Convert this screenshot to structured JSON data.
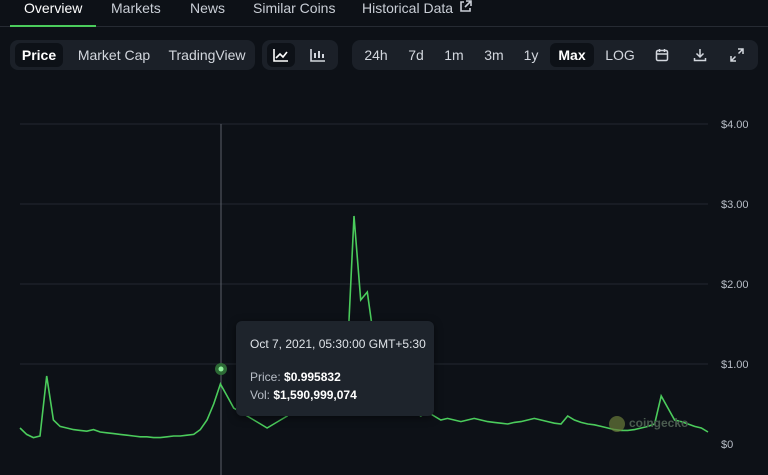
{
  "tabs": [
    {
      "label": "Overview"
    },
    {
      "label": "Markets"
    },
    {
      "label": "News"
    },
    {
      "label": "Similar Coins"
    },
    {
      "label": "Historical Data"
    }
  ],
  "toolbar": {
    "metrics": [
      "Price",
      "Market Cap",
      "TradingView"
    ],
    "selected_metric": "Price",
    "ranges": [
      "24h",
      "7d",
      "1m",
      "3m",
      "1y",
      "Max",
      "LOG"
    ],
    "selected_range": "Max",
    "icons": [
      "line-chart-icon",
      "candlestick-icon",
      "calendar-icon",
      "download-icon",
      "expand-icon"
    ]
  },
  "tooltip": {
    "date": "Oct 7, 2021, 05:30:00 GMT+5:30",
    "price_label": "Price:",
    "price_value": "$0.995832",
    "vol_label": "Vol:",
    "vol_value": "$1,590,999,074"
  },
  "watermark": {
    "text": "coingecko"
  },
  "chart_data": {
    "type": "line",
    "y_ticks": [
      "$4.00",
      "$3.00",
      "$2.00",
      "$1.00",
      "$0"
    ],
    "ylim": [
      0,
      4
    ],
    "grid": true,
    "series": [
      {
        "color": "#4bcc5c",
        "values": [
          0.2,
          0.12,
          0.08,
          0.1,
          0.85,
          0.3,
          0.22,
          0.2,
          0.18,
          0.17,
          0.16,
          0.18,
          0.15,
          0.14,
          0.13,
          0.12,
          0.11,
          0.1,
          0.09,
          0.09,
          0.08,
          0.08,
          0.09,
          0.1,
          0.1,
          0.11,
          0.12,
          0.18,
          0.3,
          0.5,
          0.75,
          0.6,
          0.45,
          0.4,
          0.35,
          0.3,
          0.25,
          0.2,
          0.25,
          0.3,
          0.35,
          0.45,
          0.6,
          0.8,
          0.9,
          0.85,
          0.95,
          1.0,
          0.9,
          1.1,
          2.85,
          1.8,
          1.9,
          1.3,
          1.0,
          0.8,
          0.6,
          0.5,
          0.45,
          0.4,
          0.35,
          0.4,
          0.35,
          0.3,
          0.32,
          0.3,
          0.28,
          0.3,
          0.32,
          0.3,
          0.28,
          0.27,
          0.26,
          0.25,
          0.27,
          0.28,
          0.3,
          0.32,
          0.3,
          0.28,
          0.26,
          0.25,
          0.35,
          0.3,
          0.27,
          0.25,
          0.24,
          0.22,
          0.2,
          0.18,
          0.17,
          0.17,
          0.18,
          0.2,
          0.22,
          0.25,
          0.6,
          0.45,
          0.3,
          0.28,
          0.25,
          0.22,
          0.2,
          0.15
        ]
      }
    ]
  }
}
